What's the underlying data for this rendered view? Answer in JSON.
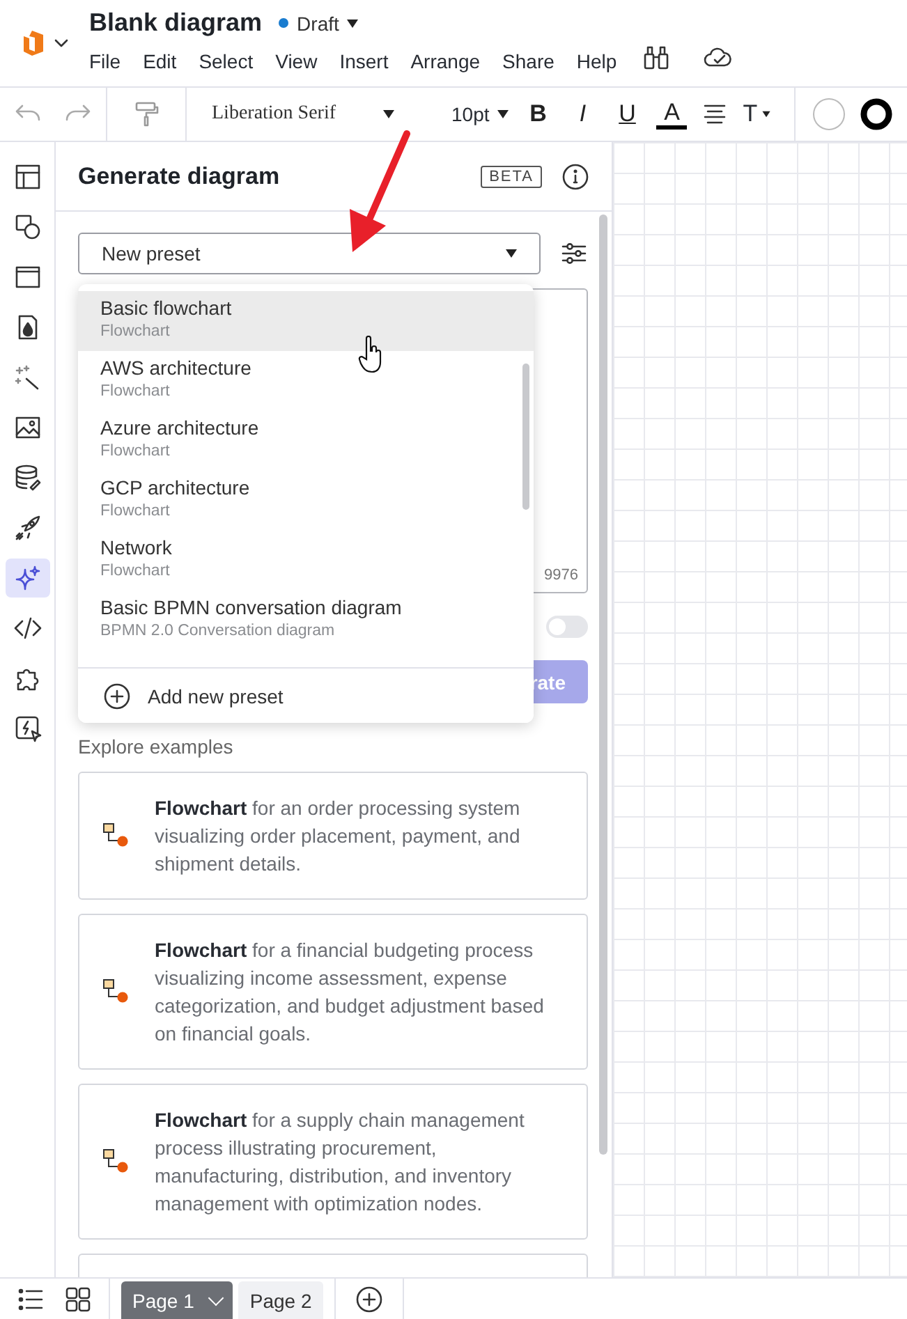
{
  "header": {
    "title": "Blank diagram",
    "status": "Draft",
    "menu": [
      "File",
      "Edit",
      "Select",
      "View",
      "Insert",
      "Arrange",
      "Share",
      "Help"
    ]
  },
  "toolbar": {
    "font": "Liberation Serif",
    "size": "10pt",
    "bold": "B",
    "italic": "I",
    "underline": "U",
    "font_color_label": "A",
    "type": "T"
  },
  "rail": [
    {
      "kind": "layout",
      "selected": false
    },
    {
      "kind": "shapes",
      "selected": false
    },
    {
      "kind": "window",
      "selected": false
    },
    {
      "kind": "fill",
      "selected": false
    },
    {
      "kind": "magic",
      "selected": false
    },
    {
      "kind": "image",
      "selected": false
    },
    {
      "kind": "data",
      "selected": false
    },
    {
      "kind": "rocket",
      "selected": false
    },
    {
      "kind": "sparkle",
      "selected": true
    },
    {
      "kind": "code",
      "selected": false
    },
    {
      "kind": "puzzle",
      "selected": false
    },
    {
      "kind": "action",
      "selected": false
    }
  ],
  "panel": {
    "title": "Generate diagram",
    "badge": "BETA",
    "preset": "New preset",
    "counter": "9976",
    "toggle_on": false,
    "generate": "rate",
    "explore": "Explore examples",
    "menu": [
      {
        "label": "Basic flowchart",
        "type": "Flowchart",
        "selected": true
      },
      {
        "label": "AWS architecture",
        "type": "Flowchart",
        "selected": false
      },
      {
        "label": "Azure architecture",
        "type": "Flowchart",
        "selected": false
      },
      {
        "label": "GCP architecture",
        "type": "Flowchart",
        "selected": false
      },
      {
        "label": "Network",
        "type": "Flowchart",
        "selected": false
      },
      {
        "label": "Basic BPMN conversation diagram",
        "type": "BPMN 2.0 Conversation diagram",
        "selected": false
      }
    ],
    "add_preset": "Add new preset",
    "examples": [
      {
        "text": "**Flowchart** for an order processing system visualizing order placement, payment, and shipment details."
      },
      {
        "text": "**Flowchart** for a financial budgeting process visualizing income assessment, expense categorization, and budget adjustment based on financial goals."
      },
      {
        "text": "**Flowchart** for a supply chain management process illustrating procurement, manufacturing, distribution, and inventory management with optimization nodes."
      }
    ]
  },
  "pages": [
    {
      "label": "Page 1",
      "selected": true
    },
    {
      "label": "Page 2",
      "selected": false
    }
  ]
}
